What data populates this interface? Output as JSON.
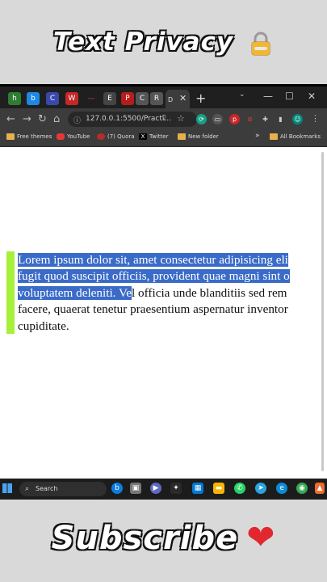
{
  "header": {
    "title": "Text Privacy",
    "lock_icon": "lock-icon"
  },
  "footer": {
    "title": "Subscribe",
    "heart": "❤"
  },
  "browser": {
    "tabs": [
      "h",
      "b",
      "C",
      "W",
      "—",
      "E",
      "P",
      "C",
      "R"
    ],
    "active_tab": "D",
    "new_tab": "+",
    "window_controls": {
      "minimize": "—",
      "maximize": "☐",
      "close": "✕"
    },
    "url": "127.0.0.1:5500/Practi...",
    "bookmarks": [
      "Free themes",
      "YouTube",
      "(7) Quora",
      "Twitter",
      "New folder"
    ],
    "bookmarks_more": "»",
    "all_bookmarks": "All Bookmarks"
  },
  "page": {
    "line1_selected": "Lorem ipsum dolor sit, amet consectetur adipisicing eli",
    "line2_selected": "fugit quod suscipit officiis, provident quae magni sint o",
    "line3_selected": "voluptatem deleniti. Ve",
    "line3_rest": "l officia unde blanditiis sed rem",
    "line4": "facere, quaerat tenetur praesentium aspernatur inventor",
    "line5": "cupiditate."
  },
  "taskbar": {
    "search_label": "Search"
  },
  "colors": {
    "selection": "#3a6bc8",
    "accent_bar": "#a6f03c",
    "heart": "#e0282e"
  }
}
